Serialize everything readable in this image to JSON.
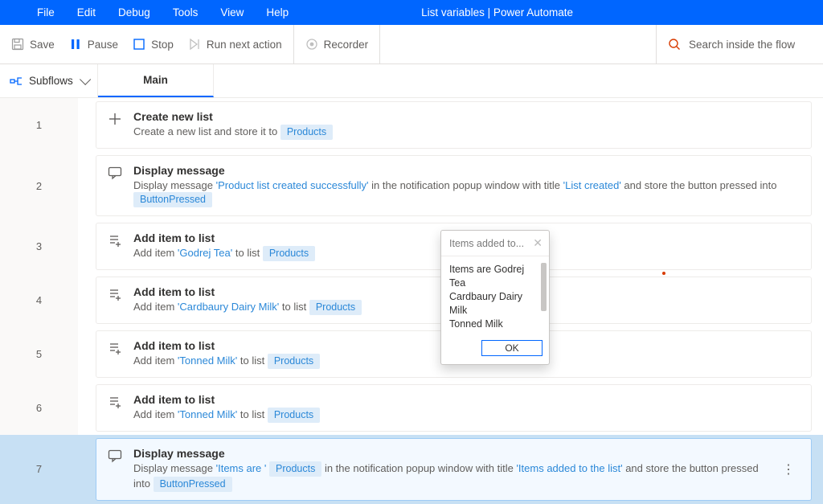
{
  "window": {
    "title": "List variables | Power Automate"
  },
  "menu": [
    "File",
    "Edit",
    "Debug",
    "Tools",
    "View",
    "Help"
  ],
  "toolbar": {
    "save": "Save",
    "pause": "Pause",
    "stop": "Stop",
    "run_next": "Run next action",
    "recorder": "Recorder",
    "search_placeholder": "Search inside the flow"
  },
  "tabs": {
    "subflows": "Subflows",
    "main": "Main"
  },
  "actions": [
    {
      "num": "1",
      "icon": "plus",
      "title": "Create new list",
      "parts": [
        {
          "t": "text",
          "v": "Create a new list and store it to "
        },
        {
          "t": "chip",
          "v": "Products"
        }
      ]
    },
    {
      "num": "2",
      "icon": "message",
      "title": "Display message",
      "parts": [
        {
          "t": "text",
          "v": "Display message "
        },
        {
          "t": "lit",
          "v": "'Product list created successfully'"
        },
        {
          "t": "text",
          "v": " in the notification popup window with title "
        },
        {
          "t": "lit",
          "v": "'List created'"
        },
        {
          "t": "text",
          "v": " and store the button pressed into "
        },
        {
          "t": "chip",
          "v": "ButtonPressed"
        }
      ]
    },
    {
      "num": "3",
      "icon": "additem",
      "title": "Add item to list",
      "parts": [
        {
          "t": "text",
          "v": "Add item "
        },
        {
          "t": "lit",
          "v": "'Godrej Tea'"
        },
        {
          "t": "text",
          "v": " to list "
        },
        {
          "t": "chip",
          "v": "Products"
        }
      ]
    },
    {
      "num": "4",
      "icon": "additem",
      "title": "Add item to list",
      "parts": [
        {
          "t": "text",
          "v": "Add item "
        },
        {
          "t": "lit",
          "v": "'Cardbaury Dairy Milk'"
        },
        {
          "t": "text",
          "v": " to list "
        },
        {
          "t": "chip",
          "v": "Products"
        }
      ]
    },
    {
      "num": "5",
      "icon": "additem",
      "title": "Add item to list",
      "parts": [
        {
          "t": "text",
          "v": "Add item "
        },
        {
          "t": "lit",
          "v": "'Tonned Milk'"
        },
        {
          "t": "text",
          "v": " to list "
        },
        {
          "t": "chip",
          "v": "Products"
        }
      ]
    },
    {
      "num": "6",
      "icon": "additem",
      "title": "Add item to list",
      "parts": [
        {
          "t": "text",
          "v": "Add item "
        },
        {
          "t": "lit",
          "v": "'Tonned Milk'"
        },
        {
          "t": "text",
          "v": " to list "
        },
        {
          "t": "chip",
          "v": "Products"
        }
      ]
    },
    {
      "num": "7",
      "icon": "message",
      "title": "Display message",
      "selected": true,
      "parts": [
        {
          "t": "text",
          "v": "Display message "
        },
        {
          "t": "lit",
          "v": "'Items are '"
        },
        {
          "t": "text",
          "v": " "
        },
        {
          "t": "chip",
          "v": "Products"
        },
        {
          "t": "text",
          "v": "  in the notification popup window with title "
        },
        {
          "t": "lit",
          "v": "'Items added to the list'"
        },
        {
          "t": "text",
          "v": " and store the button pressed into "
        },
        {
          "t": "chip",
          "v": "ButtonPressed"
        }
      ]
    }
  ],
  "dialog": {
    "title": "Items added to...",
    "body": "Items are Godrej Tea\nCardbaury Dairy Milk\nTonned Milk",
    "ok": "OK"
  }
}
